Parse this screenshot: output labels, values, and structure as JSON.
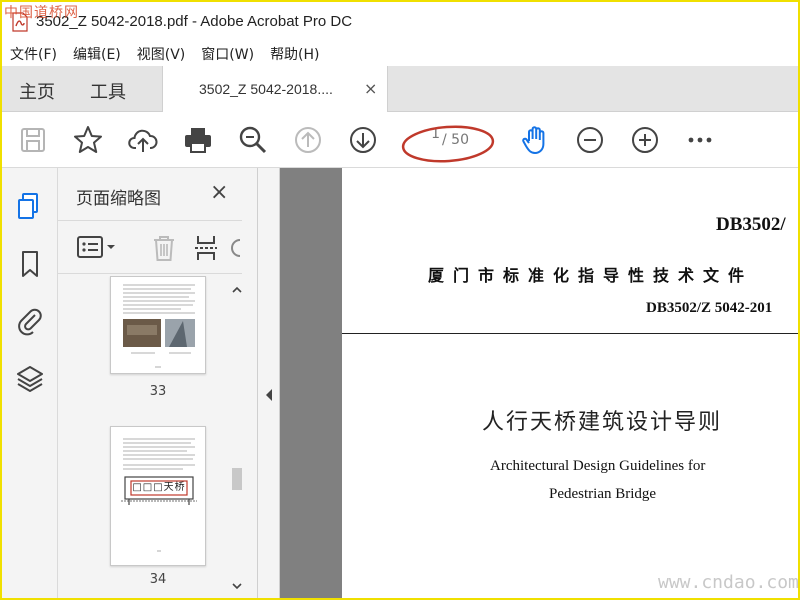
{
  "watermark_top": "中国道桥网",
  "watermark_bottom": "www.cndao.com",
  "window": {
    "title": "3502_Z 5042-2018.pdf - Adobe Acrobat Pro DC"
  },
  "menu": [
    {
      "label": "文件(F)"
    },
    {
      "label": "编辑(E)"
    },
    {
      "label": "视图(V)"
    },
    {
      "label": "窗口(W)"
    },
    {
      "label": "帮助(H)"
    }
  ],
  "tabs": {
    "home": "主页",
    "tools": "工具",
    "doc": "3502_Z 5042-2018....",
    "close": "×"
  },
  "toolbar": {
    "icons": [
      "save-icon",
      "bookmark-star-icon",
      "upload-icon",
      "print-icon",
      "zoom-search-icon",
      "page-up-icon",
      "page-down-icon",
      "hand-tool-icon",
      "zoom-out-icon",
      "zoom-in-icon",
      "more-icon"
    ],
    "page_current": "1",
    "page_total": "/ 50",
    "annotation_color": "#c0392b",
    "accent_color": "#1473e6"
  },
  "thumbnail_panel": {
    "title": "页面缩略图",
    "close": "×",
    "pages": [
      {
        "label": "33"
      },
      {
        "label": "34"
      }
    ],
    "thumb34_sign_text": "□□□天桥"
  },
  "document": {
    "code_top": "DB3502/",
    "standard_title": "厦门市标准化指导性技术文件",
    "code_sub": "DB3502/Z 5042-201",
    "cn_title": "人行天桥建筑设计导则",
    "en_title_line1": "Architectural Design Guidelines for",
    "en_title_line2": "Pedestrian Bridge"
  }
}
